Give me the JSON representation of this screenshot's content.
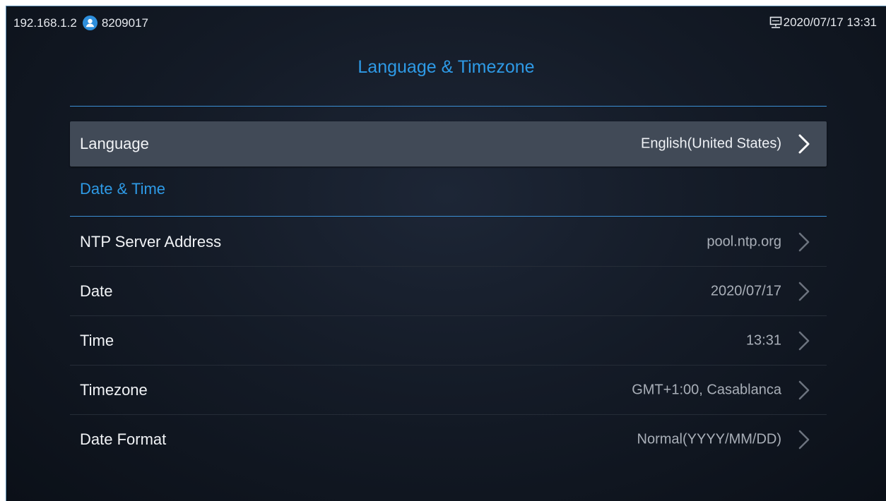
{
  "status_bar": {
    "ip_address": "192.168.1.2",
    "account": "8209017",
    "user_icon": "user-icon",
    "network_icon": "network-icon",
    "datetime": "2020/07/17 13:31"
  },
  "page": {
    "title": "Language & Timezone"
  },
  "settings": {
    "language": {
      "label": "Language",
      "value": "English(United States)",
      "icon": "chevron-right-icon"
    },
    "section_date_time": "Date & Time",
    "items": [
      {
        "label": "NTP Server Address",
        "value": "pool.ntp.org",
        "icon": "chevron-right-icon"
      },
      {
        "label": "Date",
        "value": "2020/07/17",
        "icon": "chevron-right-icon"
      },
      {
        "label": "Time",
        "value": "13:31",
        "icon": "chevron-right-icon"
      },
      {
        "label": "Timezone",
        "value": "GMT+1:00, Casablanca",
        "icon": "chevron-right-icon"
      },
      {
        "label": "Date Format",
        "value": "Normal(YYYY/MM/DD)",
        "icon": "chevron-right-icon"
      }
    ]
  },
  "colors": {
    "accent": "#2e9ae6",
    "selected_row": "#414a57",
    "background": "#141b27"
  }
}
